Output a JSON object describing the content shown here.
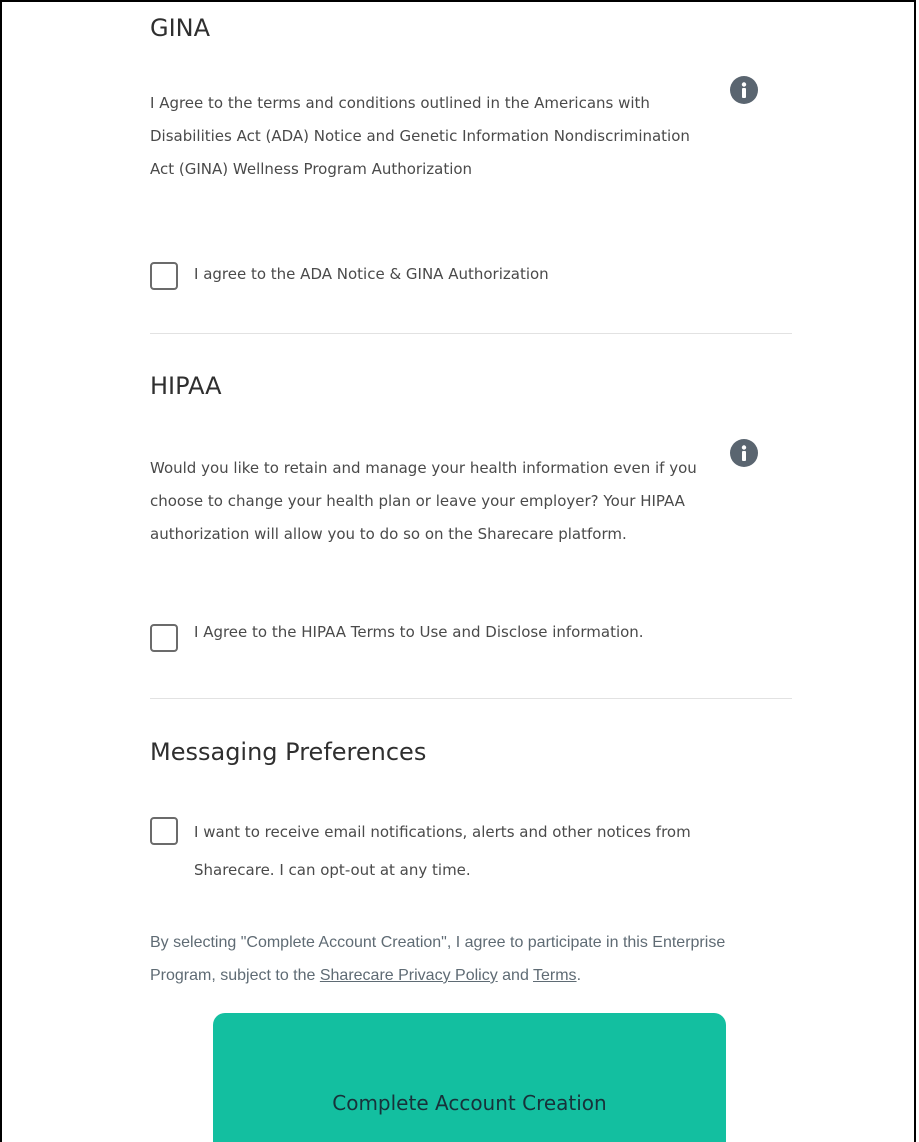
{
  "gina": {
    "title": "GINA",
    "body": "I Agree to the terms and conditions outlined in the Americans with Disabilities Act (ADA) Notice and Genetic Information Nondiscrimination Act (GINA) Wellness Program Authorization",
    "checkbox_label": "I agree to the ADA Notice & GINA Authorization",
    "checked": false
  },
  "hipaa": {
    "title": "HIPAA",
    "body": "Would you like to retain and manage your health information even if you choose to change your health plan or leave your employer? Your HIPAA authorization will allow you to do so on the Sharecare platform.",
    "checkbox_label": "I Agree to the HIPAA Terms to Use and Disclose information.",
    "checked": false
  },
  "messaging": {
    "title": "Messaging Preferences",
    "checkbox_label": "I want to receive email notifications, alerts and other notices from Sharecare. I can opt-out at any time.",
    "checked": false
  },
  "legal": {
    "prefix": "By selecting \"Complete Account Creation\", I agree to participate in this Enterprise Program, subject to the ",
    "privacy_link": "Sharecare Privacy Policy",
    "middle": " and ",
    "terms_link": "Terms",
    "suffix": "."
  },
  "cta": {
    "label": "Complete Account Creation"
  },
  "icons": {
    "info": "info-icon",
    "checkbox": "checkbox-empty"
  },
  "colors": {
    "accent": "#13bfa0",
    "info_icon": "#5a6570",
    "text": "#4a4a4a"
  }
}
